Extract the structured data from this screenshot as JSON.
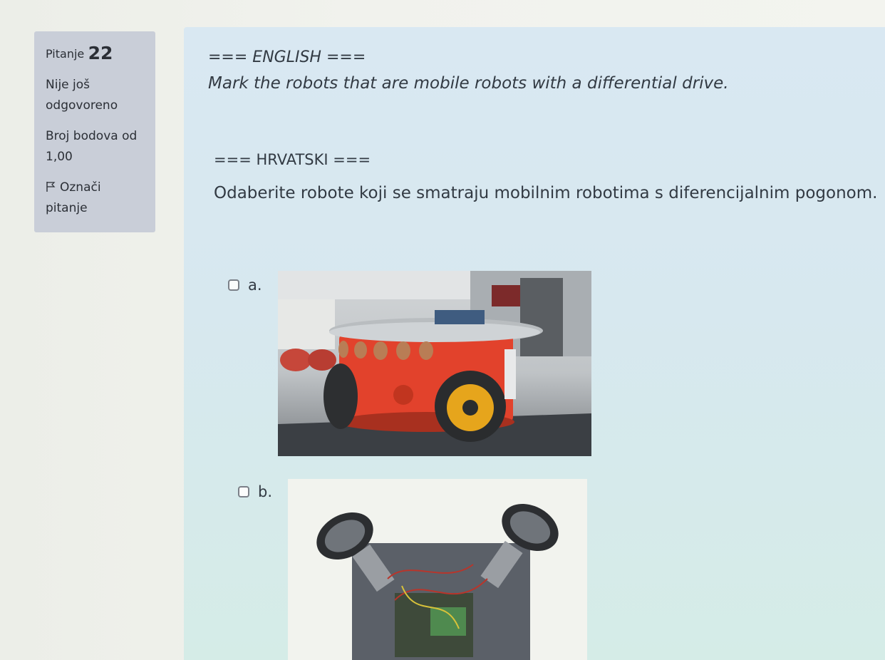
{
  "question_info": {
    "label": "Pitanje",
    "number": "22",
    "status_line1": "Nije još",
    "status_line2": "odgovoreno",
    "points_line1": "Broj bodova od",
    "points_line2": "1,00",
    "flag_line1": "Označi",
    "flag_line2": "pitanje"
  },
  "question": {
    "english_header": "=== ENGLISH ===",
    "english_text": "Mark the robots that are mobile robots with a differential drive.",
    "croatian_header": "=== HRVATSKI ===",
    "croatian_text": "Odaberite robote koji se smatraju mobilnim robotima s diferencijalnim pogonom."
  },
  "options": [
    {
      "label": "a.",
      "checked": false,
      "image": "red-differential-drive-robot"
    },
    {
      "label": "b.",
      "checked": false,
      "image": "omni-wheel-robot"
    }
  ],
  "colors": {
    "info_bg": "#c9ced8",
    "content_bg": "#d9e8f2",
    "text": "#323a43"
  }
}
